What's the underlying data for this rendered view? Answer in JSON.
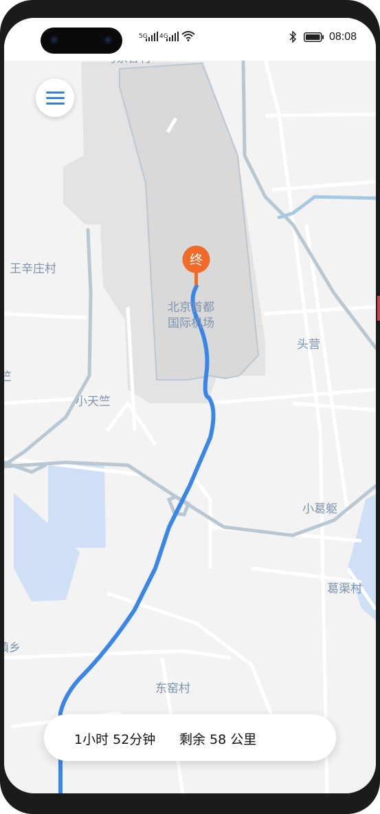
{
  "status_bar": {
    "sim1": "5G",
    "sim2": "4G",
    "time": "08:08",
    "icons": [
      "signal-icon",
      "signal-icon",
      "wifi-icon",
      "bluetooth-icon",
      "battery-icon"
    ]
  },
  "map": {
    "destination_marker": "终",
    "labels": {
      "ma_jia_ge_cun": "马家各村",
      "wang_xin_zhuang_cun": "王辛庄村",
      "airport_line1": "北京首都",
      "airport_line2": "国际机场",
      "tou_ying": "头营",
      "xiao_tian_zhu": "小天竺",
      "zhu_partial": "竺",
      "xiao_ge_qu": "小葛躯",
      "ge_qu_cun": "葛渠村",
      "xiang_partial": "镇乡",
      "dong_yao_cun": "东窑村"
    },
    "colors": {
      "route": "#3a86e6",
      "marker": "#f26a2a",
      "water": "#cfdff5",
      "airport": "#e1e1e1",
      "label": "#7e93ad"
    }
  },
  "menu": {
    "icon": "menu-icon"
  },
  "trip_info": {
    "duration": "1小时 52分钟",
    "remaining": "剩余 58 公里"
  }
}
